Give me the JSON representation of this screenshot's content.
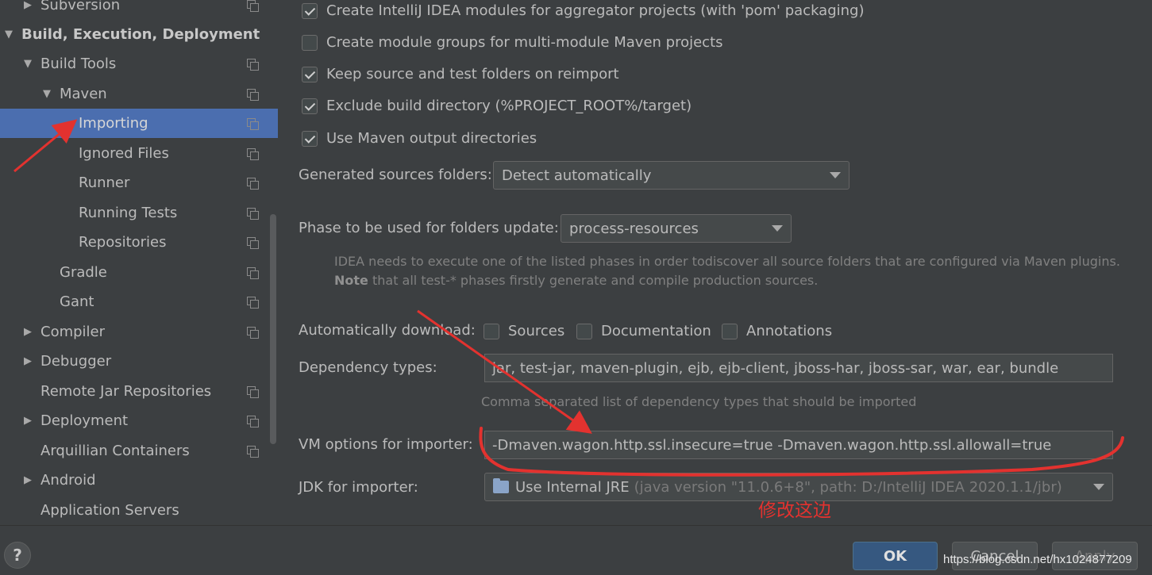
{
  "sidebar": {
    "items": [
      {
        "label": "Subversion",
        "arrow": "▶",
        "bold": false
      },
      {
        "label": "Build, Execution, Deployment",
        "arrow": "▼",
        "bold": true
      },
      {
        "label": "Build Tools",
        "arrow": "▼",
        "bold": false
      },
      {
        "label": "Maven",
        "arrow": "▼",
        "bold": false
      },
      {
        "label": "Importing",
        "arrow": "",
        "bold": false,
        "selected": true
      },
      {
        "label": "Ignored Files",
        "arrow": "",
        "bold": false
      },
      {
        "label": "Runner",
        "arrow": "",
        "bold": false
      },
      {
        "label": "Running Tests",
        "arrow": "",
        "bold": false
      },
      {
        "label": "Repositories",
        "arrow": "",
        "bold": false
      },
      {
        "label": "Gradle",
        "arrow": "",
        "bold": false
      },
      {
        "label": "Gant",
        "arrow": "",
        "bold": false
      },
      {
        "label": "Compiler",
        "arrow": "▶",
        "bold": false
      },
      {
        "label": "Debugger",
        "arrow": "▶",
        "bold": false
      },
      {
        "label": "Remote Jar Repositories",
        "arrow": "",
        "bold": false
      },
      {
        "label": "Deployment",
        "arrow": "▶",
        "bold": false
      },
      {
        "label": "Arquillian Containers",
        "arrow": "",
        "bold": false
      },
      {
        "label": "Android",
        "arrow": "▶",
        "bold": false
      },
      {
        "label": "Application Servers",
        "arrow": "",
        "bold": false
      }
    ]
  },
  "content": {
    "checkboxes": [
      {
        "label": "Create IntelliJ IDEA modules for aggregator projects (with 'pom' packaging)",
        "checked": true
      },
      {
        "label": "Create module groups for multi-module Maven projects",
        "checked": false
      },
      {
        "label": "Keep source and test folders on reimport",
        "checked": true
      },
      {
        "label": "Exclude build directory (%PROJECT_ROOT%/target)",
        "checked": true
      },
      {
        "label": "Use Maven output directories",
        "checked": true
      }
    ],
    "generated_sources": {
      "label": "Generated sources folders:",
      "value": "Detect automatically"
    },
    "phase": {
      "label": "Phase to be used for folders update:",
      "value": "process-resources"
    },
    "phase_hint_line1": "IDEA needs to execute one of the listed phases in order todiscover all source folders that are configured via Maven plugins.",
    "phase_hint_note": "Note",
    "phase_hint_line2": " that all test-* phases firstly generate and compile production sources.",
    "auto_download": {
      "label": "Automatically download:",
      "options": [
        {
          "label": "Sources",
          "checked": false
        },
        {
          "label": "Documentation",
          "checked": false
        },
        {
          "label": "Annotations",
          "checked": false
        }
      ]
    },
    "dependency_types": {
      "label": "Dependency types:",
      "value": "jar, test-jar, maven-plugin, ejb, ejb-client, jboss-har, jboss-sar, war, ear, bundle",
      "hint": "Comma separated list of dependency types that should be imported"
    },
    "vm_options": {
      "label": "VM options for importer:",
      "value": "-Dmaven.wagon.http.ssl.insecure=true -Dmaven.wagon.http.ssl.allowall=true"
    },
    "jdk": {
      "label": "JDK for importer:",
      "value": "Use Internal JRE",
      "detail": "(java version \"11.0.6+8\", path: D:/IntelliJ IDEA 2020.1.1/jbr)"
    }
  },
  "buttons": {
    "help": "?",
    "ok": "OK",
    "cancel": "Cancel",
    "apply": "Apply"
  },
  "annotation": {
    "text": "修改这边",
    "color": "#e3322f"
  },
  "watermark": "https://blog.csdn.net/hx1024877209"
}
